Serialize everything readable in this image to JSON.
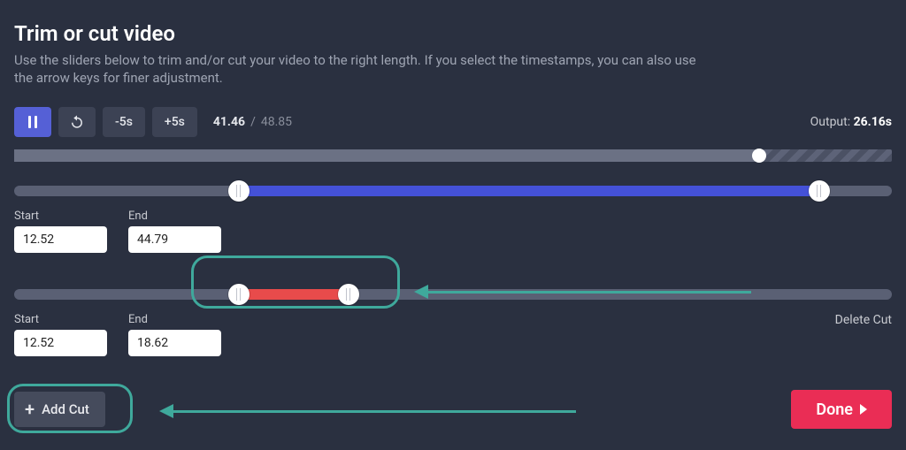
{
  "header": {
    "title": "Trim or cut video",
    "subtitle": "Use the sliders below to trim and/or cut your video to the right length. If you select the timestamps, you can also use the arrow keys for finer adjustment."
  },
  "playback": {
    "back5_label": "-5s",
    "fwd5_label": "+5s",
    "current_time": "41.46",
    "separator": "/",
    "total_time": "48.85",
    "output_label": "Output:",
    "output_value": "26.16s",
    "progress_pct": 84.9
  },
  "trim": {
    "start_label": "Start",
    "end_label": "End",
    "start_value": "12.52",
    "end_value": "44.79",
    "start_pct": 25.6,
    "end_pct": 91.7
  },
  "cut": {
    "start_label": "Start",
    "end_label": "End",
    "start_value": "12.52",
    "end_value": "18.62",
    "start_pct": 25.6,
    "end_pct": 38.1,
    "delete_label": "Delete Cut"
  },
  "footer": {
    "add_cut_label": "Add Cut",
    "done_label": "Done"
  }
}
